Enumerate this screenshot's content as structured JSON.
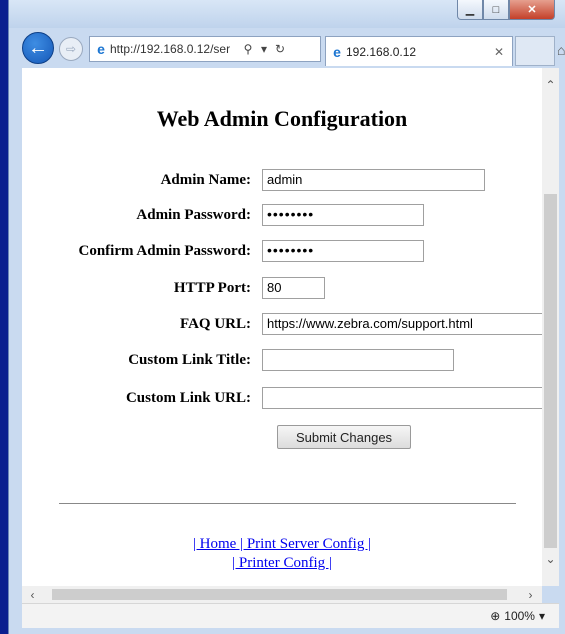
{
  "browser": {
    "url": "http://192.168.0.12/ser",
    "tab_title": "192.168.0.12",
    "zoom": "100%"
  },
  "page": {
    "title": "Web Admin Configuration",
    "fields": {
      "admin_name": {
        "label": "Admin Name:",
        "value": "admin"
      },
      "admin_password": {
        "label": "Admin Password:",
        "value": "••••••••"
      },
      "confirm_password": {
        "label": "Confirm Admin Password:",
        "value": "••••••••"
      },
      "http_port": {
        "label": "HTTP Port:",
        "value": "80"
      },
      "faq_url": {
        "label": "FAQ URL:",
        "value": "https://www.zebra.com/support.html"
      },
      "custom_link_title": {
        "label": "Custom Link Title:",
        "value": ""
      },
      "custom_link_url": {
        "label": "Custom Link URL:",
        "value": ""
      }
    },
    "submit_label": "Submit Changes",
    "links": {
      "line1": "| Home | Print Server Config |",
      "line2": "| Printer Config |"
    }
  }
}
